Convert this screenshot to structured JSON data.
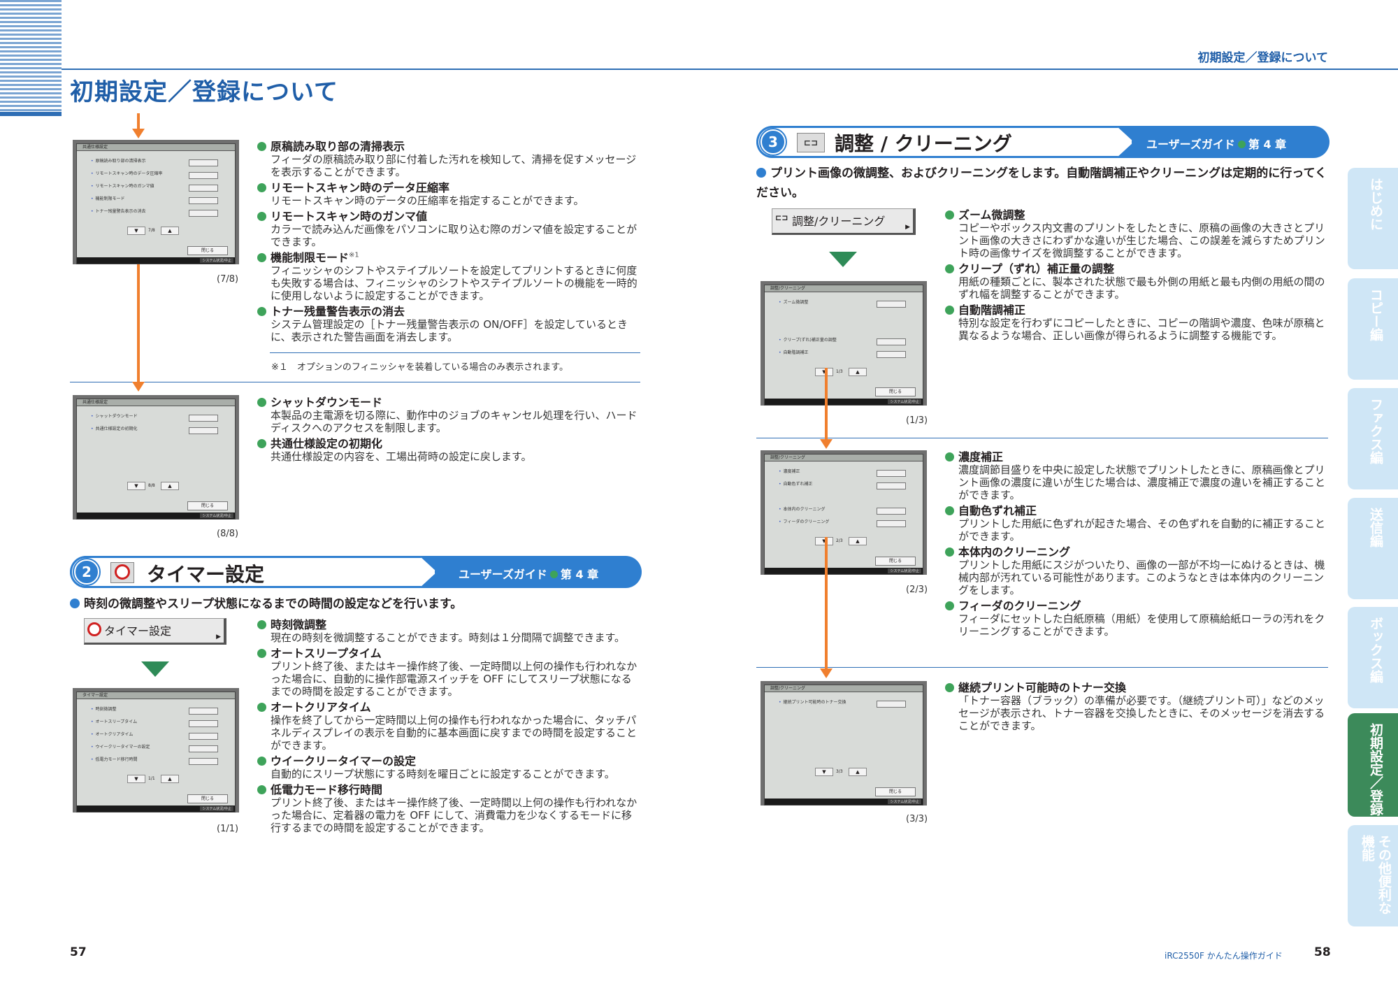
{
  "header": {
    "left_title": "初期設定／登録について",
    "right_title": "初期設定／登録について"
  },
  "footer": {
    "left_page": "57",
    "right_page": "58",
    "guide_name": "iRC2550F かんたん操作ガイド"
  },
  "colors": {
    "accent": "#2f7fd0",
    "bullet": "#3ea35a",
    "arrow": "#f07f2e",
    "tab_active": "#3c8a5a",
    "tab_inactive": "#cfe6f6"
  },
  "left_top": {
    "screen1": {
      "title": "共通仕様設定",
      "rows": [
        "原稿読み取り部の清掃表示",
        "リモートスキャン時のデータ圧縮率",
        "リモートスキャン時のガンマ値",
        "機能制限モード",
        "トナー残量警告表示の消去"
      ],
      "page": "7/8",
      "close": "閉じる",
      "status": "システム状況/中止"
    },
    "caption1": "(7/8)",
    "items1": [
      {
        "title": "原稿読み取り部の清掃表示",
        "body": "フィーダの原稿読み取り部に付着した汚れを検知して、清掃を促すメッセージを表示することができます。"
      },
      {
        "title": "リモートスキャン時のデータ圧縮率",
        "body": "リモートスキャン時のデータの圧縮率を指定することができます。"
      },
      {
        "title": "リモートスキャン時のガンマ値",
        "body": "カラーで読み込んだ画像をパソコンに取り込む際のガンマ値を設定することができます。"
      },
      {
        "title": "機能制限モード",
        "sup": "※1",
        "body": "フィニッシャのシフトやステイプルソートを設定してプリントするときに何度も失敗する場合は、フィニッシャのシフトやステイプルソートの機能を一時的に使用しないように設定することができます。"
      },
      {
        "title": "トナー残量警告表示の消去",
        "body": "システム管理設定の［トナー残量警告表示の ON/OFF］を設定しているときに、表示された警告画面を消去します。"
      }
    ],
    "note": "※１　オプションのフィニッシャを装着している場合のみ表示されます。",
    "screen2": {
      "title": "共通仕様設定",
      "rows": [
        "シャットダウンモード",
        "共通仕様設定の初期化"
      ],
      "page": "8/8",
      "close": "閉じる",
      "status": "システム状況/中止"
    },
    "caption2": "(8/8)",
    "items2": [
      {
        "title": "シャットダウンモード",
        "body": "本製品の主電源を切る際に、動作中のジョブのキャンセル処理を行い、ハードディスクへのアクセスを制限します。"
      },
      {
        "title": "共通仕様設定の初期化",
        "body": "共通仕様設定の内容を、工場出荷時の設定に戻します。"
      }
    ]
  },
  "section2": {
    "num": "2",
    "title": "タイマー設定",
    "guide": "ユーザーズガイド",
    "chapter": "第 4 章",
    "lead": "時刻の微調整やスリープ状態になるまでの時間の設定などを行います。",
    "button": "タイマー設定",
    "screen": {
      "title": "タイマー設定",
      "rows": [
        "時刻微調整",
        "オートスリープタイム",
        "オートクリアタイム",
        "ウイークリータイマーの設定",
        "低電力モード移行時間"
      ],
      "page": "1/1",
      "close": "閉じる",
      "status": "システム状況/中止"
    },
    "caption": "(1/1)",
    "items": [
      {
        "title": "時刻微調整",
        "body": "現在の時刻を微調整することができます。時刻は１分間隔で調整できます。"
      },
      {
        "title": "オートスリープタイム",
        "body": "プリント終了後、またはキー操作終了後、一定時間以上何の操作も行われなかった場合に、自動的に操作部電源スイッチを OFF にしてスリープ状態になるまでの時間を設定することができます。"
      },
      {
        "title": "オートクリアタイム",
        "body": "操作を終了してから一定時間以上何の操作も行われなかった場合に、タッチパネルディスプレイの表示を自動的に基本画面に戻すまでの時間を設定することができます。"
      },
      {
        "title": "ウイークリータイマーの設定",
        "body": "自動的にスリープ状態にする時刻を曜日ごとに設定することができます。"
      },
      {
        "title": "低電力モード移行時間",
        "body": "プリント終了後、またはキー操作終了後、一定時間以上何の操作も行われなかった場合に、定着器の電力を OFF にして、消費電力を少なくするモードに移行するまでの時間を設定することができます。"
      }
    ]
  },
  "section3": {
    "num": "3",
    "title": "調整 / クリーニング",
    "guide": "ユーザーズガイド",
    "chapter": "第 4 章",
    "lead": "プリント画像の微調整、およびクリーニングをします。自動階調補正やクリーニングは定期的に行ってください。",
    "button": "調整/クリーニング",
    "screen1": {
      "title": "調整/クリーニング",
      "rows": [
        "ズーム微調整",
        "クリープ(ずれ)補正量の調整",
        "自動階調補正"
      ],
      "page": "1/3",
      "close": "閉じる",
      "status": "システム状況/中止"
    },
    "caption1": "(1/3)",
    "items1": [
      {
        "title": "ズーム微調整",
        "body": "コピーやボックス内文書のプリントをしたときに、原稿の画像の大きさとプリント画像の大きさにわずかな違いが生じた場合、この誤差を減らすためプリント時の画像サイズを微調整することができます。"
      },
      {
        "title": "クリープ（ずれ）補正量の調整",
        "body": "用紙の種類ごとに、製本された状態で最も外側の用紙と最も内側の用紙の間のずれ幅を調整することができます。"
      },
      {
        "title": "自動階調補正",
        "body": "特別な設定を行わずにコピーしたときに、コピーの階調や濃度、色味が原稿と異なるような場合、正しい画像が得られるように調整する機能です。"
      }
    ],
    "screen2": {
      "title": "調整/クリーニング",
      "rows": [
        "濃度補正",
        "自動色ずれ補正",
        "本体内のクリーニング",
        "フィーダのクリーニング"
      ],
      "page": "2/3",
      "close": "閉じる",
      "status": "システム状況/中止"
    },
    "caption2": "(2/3)",
    "items2": [
      {
        "title": "濃度補正",
        "body": "濃度調節目盛りを中央に設定した状態でプリントしたときに、原稿画像とプリント画像の濃度に違いが生じた場合は、濃度補正で濃度の違いを補正することができます。"
      },
      {
        "title": "自動色ずれ補正",
        "body": "プリントした用紙に色ずれが起きた場合、その色ずれを自動的に補正することができます。"
      },
      {
        "title": "本体内のクリーニング",
        "body": "プリントした用紙にスジがついたり、画像の一部が不均一にぬけるときは、機械内部が汚れている可能性があります。このようなときは本体内のクリーニングをします。"
      },
      {
        "title": "フィーダのクリーニング",
        "body": "フィーダにセットした白紙原稿（用紙）を使用して原稿給紙ローラの汚れをクリーニングすることができます。"
      }
    ],
    "screen3": {
      "title": "調整/クリーニング",
      "rows": [
        "継続プリント可能時のトナー交換"
      ],
      "page": "3/3",
      "close": "閉じる",
      "status": "システム状況/中止"
    },
    "caption3": "(3/3)",
    "items3": [
      {
        "title": "継続プリント可能時のトナー交換",
        "body": "「トナー容器（ブラック）の準備が必要です。（継続プリント可）」などのメッセージが表示され、トナー容器を交換したときに、そのメッセージを消去することができます。"
      }
    ]
  },
  "side_tabs": [
    {
      "label": "はじめに",
      "active": false
    },
    {
      "label": "コピー編",
      "active": false
    },
    {
      "label": "ファクス編",
      "active": false
    },
    {
      "label": "送信編",
      "active": false
    },
    {
      "label": "ボックス編",
      "active": false
    },
    {
      "label": "初期設定／登録",
      "active": true
    },
    {
      "label": "その他便利な機能",
      "active": false
    }
  ]
}
